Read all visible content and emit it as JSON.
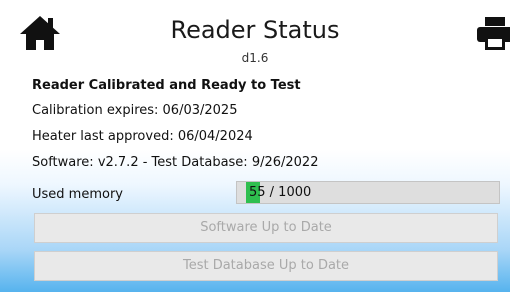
{
  "header": {
    "title": "Reader Status",
    "version": "d1.6",
    "home_icon": "home-icon",
    "print_icon": "printer-icon"
  },
  "status": {
    "headline": "Reader Calibrated and Ready to Test",
    "calibration": "Calibration expires: 06/03/2025",
    "heater": "Heater last approved: 06/04/2024",
    "software": "Software: v2.7.2 - Test Database: 9/26/2022"
  },
  "memory": {
    "label": "Used memory",
    "display": "55 / 1000",
    "used": 55,
    "total": 1000,
    "fill_color": "#2fbf4f"
  },
  "buttons": {
    "software": "Software Up to Date",
    "database": "Test Database Up to Date"
  }
}
